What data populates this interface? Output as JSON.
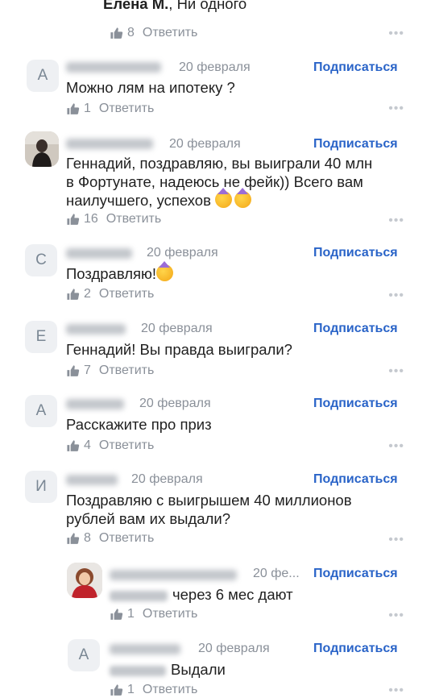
{
  "top_comment": {
    "name": "Елена М.",
    "text": ", Ни одного",
    "likes": "8",
    "reply": "Ответить"
  },
  "comments": [
    {
      "avatar_letter": "А",
      "date": "20 февраля",
      "subscribe": "Подписаться",
      "text": "Можно лям на ипотеку ?",
      "likes": "1",
      "reply": "Ответить"
    },
    {
      "avatar_letter": "",
      "date": "20 февраля",
      "subscribe": "Подписаться",
      "text_lines": [
        "Геннадий, поздравляю, вы выиграли 40 млн",
        "в Фортунате, надеюсь не фейк)) Всего вам",
        "наилучшего, успехов"
      ],
      "likes": "16",
      "reply": "Ответить"
    },
    {
      "avatar_letter": "С",
      "date": "20 февраля",
      "subscribe": "Подписаться",
      "text": "Поздравляю!",
      "likes": "2",
      "reply": "Ответить"
    },
    {
      "avatar_letter": "Е",
      "date": "20 февраля",
      "subscribe": "Подписаться",
      "text": "Геннадий! Вы правда выиграли?",
      "likes": "7",
      "reply": "Ответить"
    },
    {
      "avatar_letter": "А",
      "date": "20 февраля",
      "subscribe": "Подписаться",
      "text": "Расскажите про приз",
      "likes": "4",
      "reply": "Ответить"
    },
    {
      "avatar_letter": "И",
      "date": "20 февраля",
      "subscribe": "Подписаться",
      "text_lines": [
        "Поздравляю с выигрышем 40 миллионов",
        "рублей вам их выдали?"
      ],
      "likes": "8",
      "reply": "Ответить"
    }
  ],
  "replies": [
    {
      "avatar_letter": "",
      "date": "20 фе...",
      "subscribe": "Подписаться",
      "text": "через 6 мес дают",
      "likes": "1",
      "reply": "Ответить"
    },
    {
      "avatar_letter": "А",
      "date": "20 февраля",
      "subscribe": "Подписаться",
      "text": "Выдали",
      "likes": "1",
      "reply": "Ответить"
    }
  ],
  "more_label": "•••",
  "colors": {
    "accent": "#2a64c8",
    "muted": "#8a9099",
    "avatar_bg": "#eef0f3"
  }
}
